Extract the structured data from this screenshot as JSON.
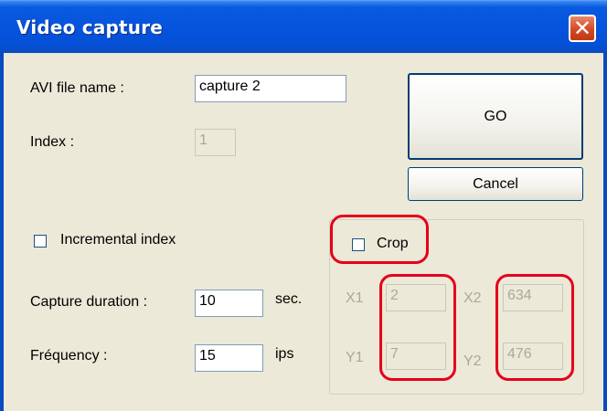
{
  "window": {
    "title": "Video capture",
    "close_glyph": "✕"
  },
  "form": {
    "avi_label": "AVI file name :",
    "avi_value": "capture 2",
    "index_label": "Index :",
    "index_value": "1",
    "incremental_label": "Incremental index",
    "incremental_checked": false,
    "duration_label": "Capture duration :",
    "duration_value": "10",
    "duration_unit": "sec.",
    "frequency_label": "Fréquency :",
    "frequency_value": "15",
    "frequency_unit": "ips"
  },
  "buttons": {
    "go": "GO",
    "cancel": "Cancel"
  },
  "crop": {
    "label": "Crop",
    "checked": false,
    "x1_label": "X1",
    "x1_value": "2",
    "x2_label": "X2",
    "x2_value": "634",
    "y1_label": "Y1",
    "y1_value": "7",
    "y2_label": "Y2",
    "y2_value": "476"
  },
  "annotations": {
    "color": "#e5001b"
  }
}
